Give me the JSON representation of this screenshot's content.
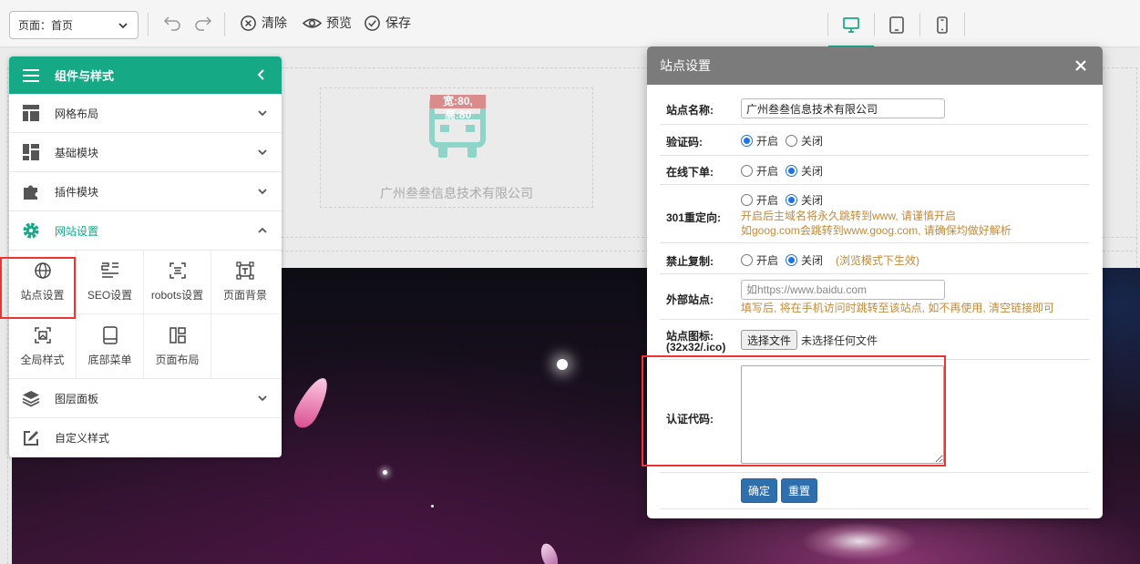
{
  "toolbar": {
    "page_select": "页面：首页",
    "clear_label": "清除",
    "preview_label": "预览",
    "save_label": "保存"
  },
  "canvas": {
    "logo_size": "宽:80,高:80",
    "company_name": "广州叁叁信息技术有限公司"
  },
  "panel": {
    "title": "组件与样式",
    "menu": {
      "grid_layout": "网格布局",
      "basic_modules": "基础模块",
      "plugin_modules": "插件模块",
      "site_settings": "网站设置",
      "layer_panel": "图层面板",
      "custom_style": "自定义样式"
    },
    "site_items": [
      {
        "label": "站点设置",
        "icon": "globe-icon"
      },
      {
        "label": "SEO设置",
        "icon": "seo-icon"
      },
      {
        "label": "robots设置",
        "icon": "robots-icon"
      },
      {
        "label": "页面背景",
        "icon": "background-icon"
      },
      {
        "label": "全局样式",
        "icon": "global-style-icon"
      },
      {
        "label": "底部菜单",
        "icon": "bottom-menu-icon"
      },
      {
        "label": "页面布局",
        "icon": "page-layout-icon"
      }
    ]
  },
  "modal": {
    "title": "站点设置",
    "site_name_label": "站点名称:",
    "site_name_value": "广州叁叁信息技术有限公司",
    "captcha_label": "验证码:",
    "online_order_label": "在线下单:",
    "redirect_label": "301重定向:",
    "redirect_hint1": "开启后主域名将永久跳转到www, 请谨慎开启",
    "redirect_hint2": "如goog.com会跳转到www.goog.com, 请确保均做好解析",
    "copy_label": "禁止复制:",
    "copy_hint": "(浏览模式下生效)",
    "external_label": "外部站点:",
    "external_placeholder": "如https://www.baidu.com",
    "external_hint": "填写后, 将在手机访问时跳转至该站点, 如不再使用, 清空链接即可",
    "favicon_label_1": "站点图标:",
    "favicon_label_2": "(32x32/.ico)",
    "file_button": "选择文件",
    "file_status": "未选择任何文件",
    "auth_label": "认证代码:",
    "on": "开启",
    "off": "关闭",
    "confirm": "确定",
    "reset": "重置"
  },
  "colors": {
    "accent": "#16a985",
    "primary_button": "#2f6fae",
    "hint": "#c48a3a",
    "highlight": "#ee3333"
  }
}
